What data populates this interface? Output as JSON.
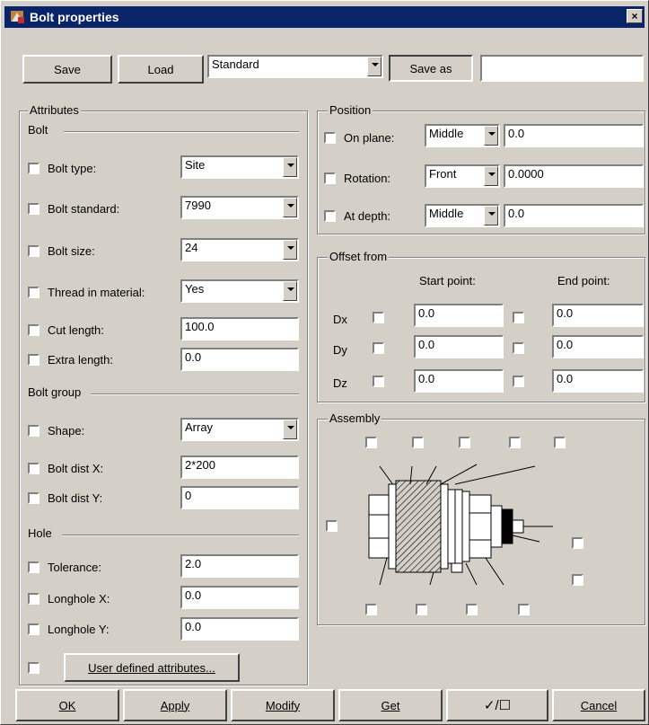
{
  "title": "Bolt properties",
  "close_glyph": "×",
  "toolbar": {
    "save": "Save",
    "load": "Load",
    "preset": "Standard",
    "save_as": "Save as",
    "save_as_name": ""
  },
  "attributes": {
    "group_label": "Attributes",
    "bolt_section": "Bolt",
    "bolt_type": {
      "label": "Bolt type:",
      "value": "Site"
    },
    "bolt_standard": {
      "label": "Bolt standard:",
      "value": "7990"
    },
    "bolt_size": {
      "label": "Bolt size:",
      "value": "24"
    },
    "thread": {
      "label": "Thread in material:",
      "value": "Yes"
    },
    "cut_length": {
      "label": "Cut length:",
      "value": "100.0"
    },
    "extra_length": {
      "label": "Extra length:",
      "value": "0.0"
    },
    "group_section": "Bolt group",
    "shape": {
      "label": "Shape:",
      "value": "Array"
    },
    "dist_x": {
      "label": "Bolt dist X:",
      "value": "2*200"
    },
    "dist_y": {
      "label": "Bolt dist Y:",
      "value": "0"
    },
    "hole_section": "Hole",
    "tolerance": {
      "label": "Tolerance:",
      "value": "2.0"
    },
    "longhole_x": {
      "label": "Longhole X:",
      "value": "0.0"
    },
    "longhole_y": {
      "label": "Longhole Y:",
      "value": "0.0"
    },
    "user_defined": "User defined attributes..."
  },
  "position": {
    "group_label": "Position",
    "on_plane": {
      "label": "On plane:",
      "option": "Middle",
      "value": "0.0"
    },
    "rotation": {
      "label": "Rotation:",
      "option": "Front",
      "value": "0.0000"
    },
    "at_depth": {
      "label": "At depth:",
      "option": "Middle",
      "value": "0.0"
    }
  },
  "offset": {
    "group_label": "Offset from",
    "start_header": "Start point:",
    "end_header": "End point:",
    "rows": [
      {
        "label": "Dx",
        "start": "0.0",
        "end": "0.0"
      },
      {
        "label": "Dy",
        "start": "0.0",
        "end": "0.0"
      },
      {
        "label": "Dz",
        "start": "0.0",
        "end": "0.0"
      }
    ]
  },
  "assembly": {
    "group_label": "Assembly"
  },
  "footer": {
    "ok": "OK",
    "apply": "Apply",
    "modify": "Modify",
    "get": "Get",
    "toggle": "✓/☐",
    "cancel": "Cancel"
  }
}
